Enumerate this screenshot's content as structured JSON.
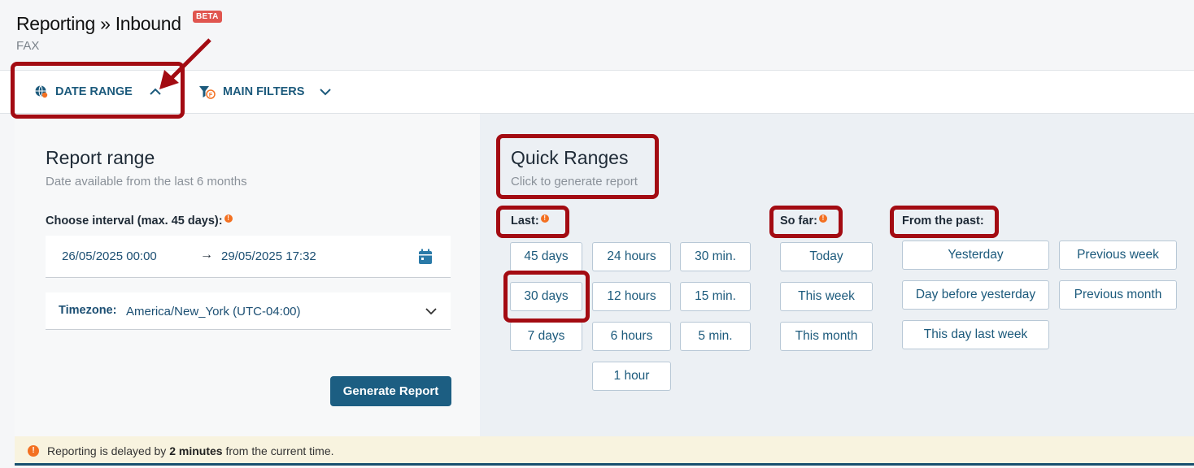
{
  "header": {
    "title": "Reporting » Inbound",
    "badge": "BETA",
    "subtitle": "FAX"
  },
  "tabs": {
    "date_range": "DATE RANGE",
    "main_filters": "MAIN FILTERS"
  },
  "report_range": {
    "title": "Report range",
    "hint": "Date available from the last 6 months",
    "interval_label": "Choose interval (max. 45 days):",
    "date_start": "26/05/2025 00:00",
    "date_arrow": "→",
    "date_end": "29/05/2025 17:32",
    "timezone_label": "Timezone:",
    "timezone_value": "America/New_York (UTC-04:00)",
    "generate_button": "Generate Report"
  },
  "quick_ranges": {
    "title": "Quick Ranges",
    "hint": "Click to generate report",
    "last_label": "Last:",
    "so_far_label": "So far:",
    "from_past_label": "From the past:",
    "last": {
      "days": [
        "45 days",
        "30 days",
        "7 days"
      ],
      "hours": [
        "24 hours",
        "12 hours",
        "6 hours",
        "1 hour"
      ],
      "minutes": [
        "30 min.",
        "15 min.",
        "5 min."
      ]
    },
    "so_far": [
      "Today",
      "This week",
      "This month"
    ],
    "from_past_col1": [
      "Yesterday",
      "Day before yesterday",
      "This day last week"
    ],
    "from_past_col2": [
      "Previous week",
      "Previous month"
    ]
  },
  "notice": {
    "icon": "!",
    "prefix": "Reporting is delayed by ",
    "bold": "2 minutes",
    "suffix": " from the current time."
  },
  "colors": {
    "accent": "#1c5e82",
    "annotation": "#a30b12",
    "info": "#f37021"
  }
}
